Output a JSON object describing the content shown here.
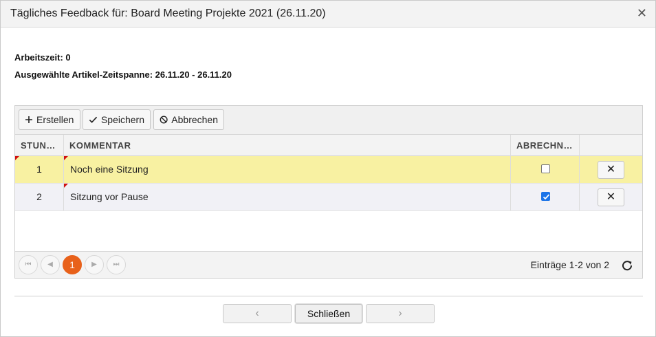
{
  "dialog": {
    "title": "Tägliches Feedback für: Board Meeting Projekte 2021 (26.11.20)",
    "close_icon": "close-icon"
  },
  "info": {
    "worktime": "Arbeitszeit: 0",
    "timespan": "Ausgewählte Artikel-Zeitspanne: 26.11.20 - 26.11.20"
  },
  "toolbar": {
    "create_label": "Erstellen",
    "save_label": "Speichern",
    "cancel_label": "Abbrechen"
  },
  "table": {
    "columns": [
      "STUN…",
      "KOMMENTAR",
      "ABRECHN…",
      ""
    ],
    "rows": [
      {
        "hours": "1",
        "comment": "Noch eine Sitzung",
        "billable": false,
        "delete": "✕"
      },
      {
        "hours": "2",
        "comment": "Sitzung vor Pause",
        "billable": true,
        "delete": "✕"
      }
    ],
    "row_colors": {
      "selected": "#f8f1a2",
      "alt": "#f1f1f6"
    }
  },
  "pager": {
    "current_page": "1",
    "info": "Einträge 1-2 von 2",
    "accent": "#e8611a"
  },
  "footer": {
    "prev": "‹",
    "close_label": "Schließen",
    "next": "›"
  }
}
